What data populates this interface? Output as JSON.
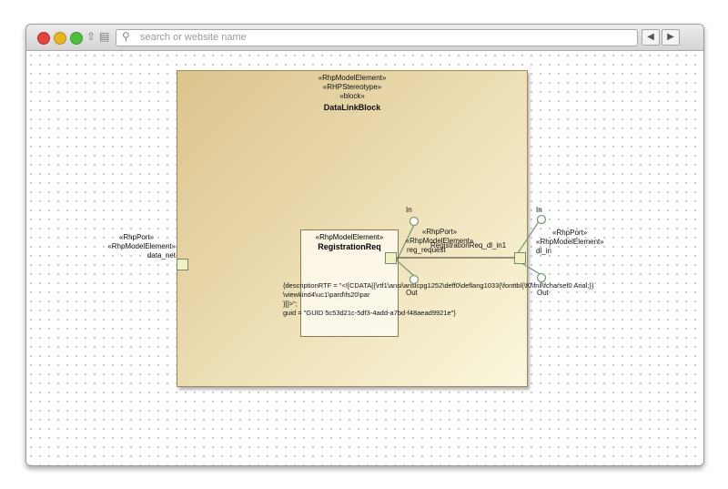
{
  "browser": {
    "search_placeholder": "search or website name",
    "back_icon": "◀",
    "forward_icon": "▶"
  },
  "diagram": {
    "block": {
      "stereotypes": [
        "«RhpModelElement»",
        "«RHPStereotype»",
        "«block»"
      ],
      "name": "DataLinkBlock"
    },
    "part": {
      "stereotype": "«RhpModelElement»",
      "name": "RegistrationReq"
    },
    "left_port": {
      "stereotypes": [
        "«RhpPort»",
        "«RhpModelElement»"
      ],
      "name": "data_net"
    },
    "inner_port": {
      "stereotypes": [
        "«RhpPort»",
        "«RhpModelElement»"
      ],
      "name": "reg_request",
      "connector": "RegistrationReq_dl_in1",
      "in_label": "In",
      "out_label": "Out"
    },
    "right_port": {
      "stereotypes": [
        "«RhpPort»",
        "«RhpModelElement»"
      ],
      "name": "dl_in",
      "in_label": "In",
      "out_label": "Out"
    },
    "description": [
      "{descriptionRTF = \"<![CDATA[{\\rtf1\\ansi\\ansicpg1252\\deff0\\deflang1033{\\fonttbl{\\f0\\fnil\\fcharset0 Arial;}}",
      "\\viewkind4\\uc1\\pard\\fs20\\par",
      "}]]>\";",
      "guid = \"GUID 5c53d21c-5df3-4add-a7bd-f48aead9921e\"}"
    ]
  }
}
